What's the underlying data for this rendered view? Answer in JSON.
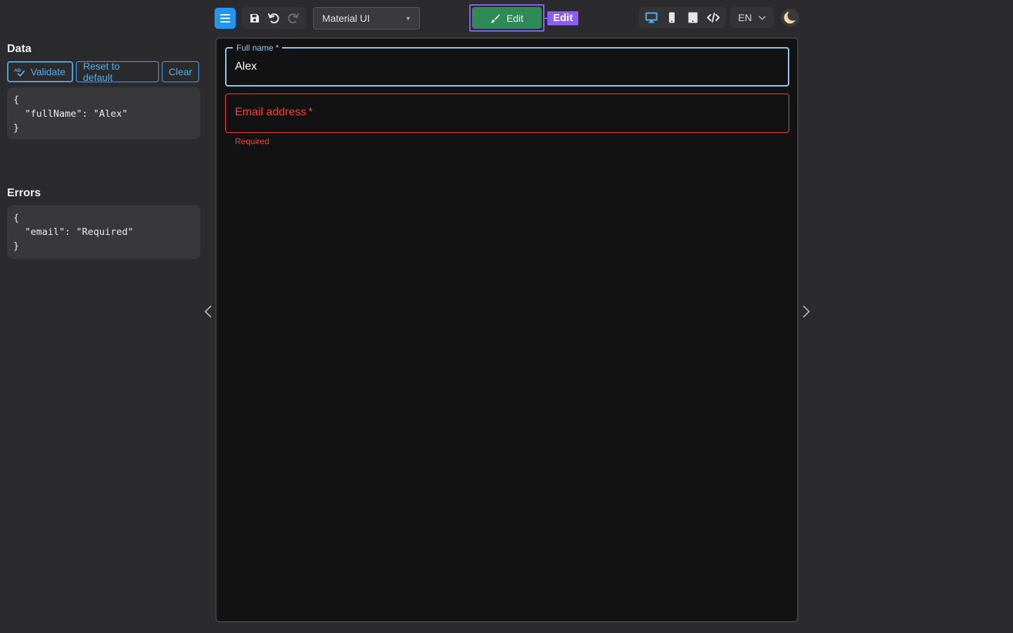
{
  "toolbar": {
    "theme_select": "Material UI",
    "edit_label": "Edit",
    "edit_tag": "Edit",
    "language": "EN"
  },
  "left_panel": {
    "data_title": "Data",
    "buttons": {
      "validate": "Validate",
      "reset": "Reset to default",
      "clear": "Clear"
    },
    "data_json": "{\n  \"fullName\": \"Alex\"\n}",
    "errors_title": "Errors",
    "errors_json": "{\n  \"email\": \"Required\"\n}"
  },
  "form": {
    "full_name_label": "Full name",
    "full_name_value": "Alex",
    "email_label": "Email address",
    "required_mark": "*",
    "email_helper": "Required"
  },
  "colors": {
    "accent": "#2196f3",
    "edit_green": "#2e8b57",
    "edit_highlight": "#8b5cf6",
    "error": "#f44336",
    "focus": "#90caf9"
  },
  "icons": {
    "menu": "hamburger-icon",
    "save": "save-icon",
    "undo": "undo-icon",
    "redo": "redo-icon",
    "edit": "brush-icon",
    "desktop": "desktop-icon",
    "mobile": "mobile-icon",
    "tablet": "tablet-icon",
    "code": "code-icon",
    "theme": "moon-icon",
    "prev": "chevron-left-icon",
    "next": "chevron-right-icon"
  }
}
